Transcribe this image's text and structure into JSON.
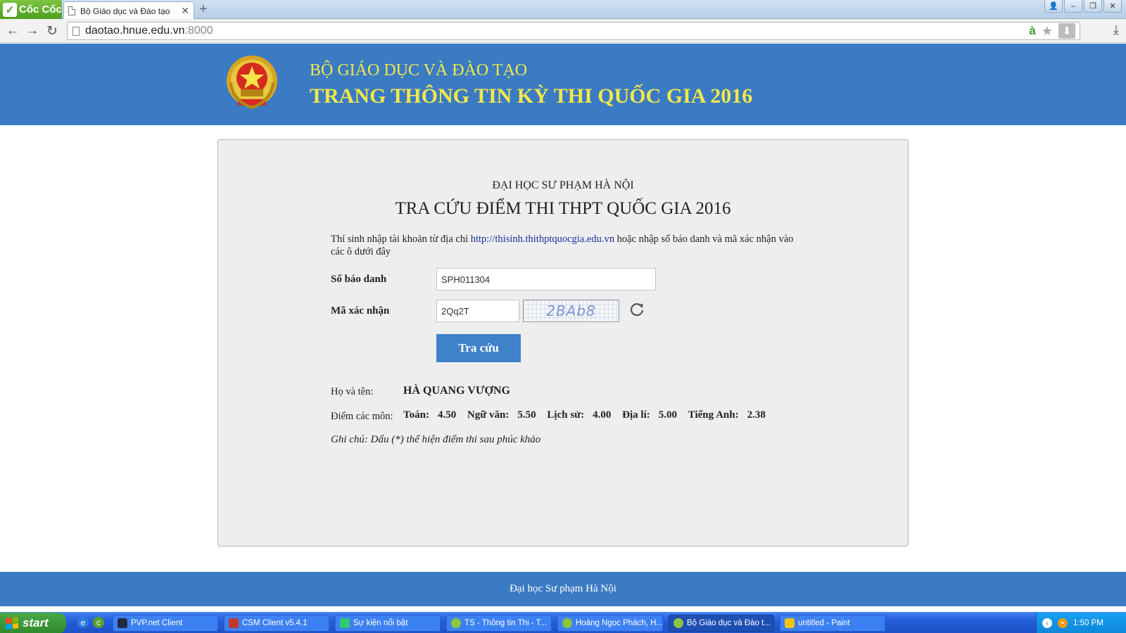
{
  "browser": {
    "brand": "Cốc Cốc",
    "tab_title": "Bộ Giáo dục và Đào tạo",
    "url_host": "daotao.hnue.edu.vn",
    "url_port": ":8000"
  },
  "header": {
    "line1": "BỘ GIÁO DỤC VÀ ĐÀO TẠO",
    "line2": "TRANG THÔNG TIN KỲ THI QUỐC GIA 2016"
  },
  "form": {
    "university": "ĐẠI HỌC SƯ PHẠM HÀ NỘI",
    "title": "TRA CỨU ĐIỂM THI THPT QUỐC GIA 2016",
    "instruction_pre": "Thí sinh nhập tài khoản từ địa chỉ ",
    "instruction_link": "http://thisinh.thithptquocgia.edu.vn",
    "instruction_post": " hoặc nhập số báo danh và mã xác nhận vào các ô dưới đây",
    "sbd_label": "Số báo danh",
    "sbd_value": "SPH011304",
    "captcha_label": "Mã xác nhận",
    "captcha_value": "2Qq2T",
    "captcha_image_text": "2BAb8",
    "submit_label": "Tra cứu"
  },
  "result": {
    "name_label": "Họ và tên:",
    "name_value": "HÀ QUANG VƯỢNG",
    "scores_label": "Điểm các môn:",
    "subjects": [
      {
        "name": "Toán:",
        "score": "4.50"
      },
      {
        "name": "Ngữ văn:",
        "score": "5.50"
      },
      {
        "name": "Lịch sử:",
        "score": "4.00"
      },
      {
        "name": "Địa lí:",
        "score": "5.00"
      },
      {
        "name": "Tiếng Anh:",
        "score": "2.38"
      }
    ],
    "note": "Ghi chú: Dấu (*) thể hiện điểm thi sau phúc khảo"
  },
  "footer": {
    "text": "Đại học Sư phạm Hà Nội"
  },
  "taskbar": {
    "start_label": "start",
    "buttons": [
      "PVP.net Client",
      "CSM Client v5.4.1",
      "Sự kiện nổi bật",
      "TS - Thông tin Thi - T...",
      "Hoàng Ngọc Phách, H...",
      "Bộ Giáo dục và Đào t...",
      "untitled - Paint"
    ],
    "clock": "1:50 PM"
  },
  "colors": {
    "header_blue": "#3b7bc3",
    "header_text_yellow": "#f3e84a",
    "button_blue": "#3e83c9",
    "card_bg": "#eeeeee",
    "link": "#1a31a0"
  }
}
